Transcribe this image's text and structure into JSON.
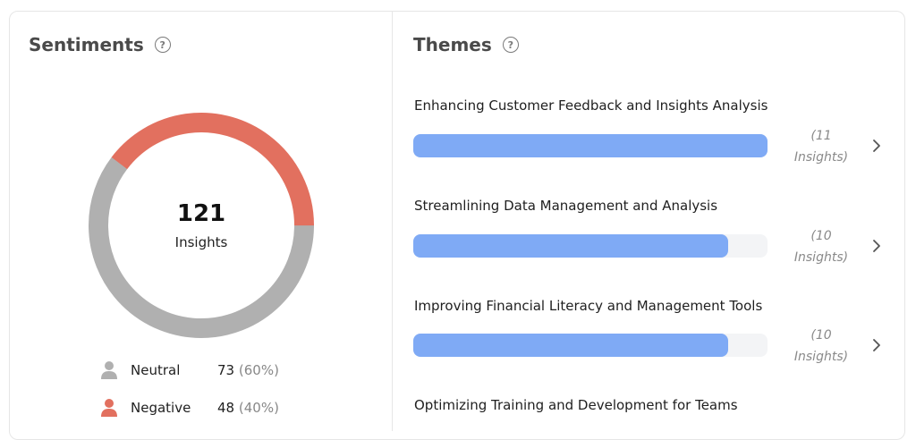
{
  "sentiments": {
    "title": "Sentiments",
    "total": "121",
    "total_label": "Insights",
    "legend": [
      {
        "name": "Neutral",
        "count": "73",
        "percent": "(60%)",
        "value": 73,
        "color": "#b0b0b0"
      },
      {
        "name": "Negative",
        "count": "48",
        "percent": "(40%)",
        "value": 48,
        "color": "#e2705f"
      }
    ]
  },
  "themes": {
    "title": "Themes",
    "items": [
      {
        "title": "Enhancing Customer Feedback and Insights Analysis",
        "count_line1": "(11",
        "count_line2": "Insights)",
        "fraction": 1.0
      },
      {
        "title": "Streamlining Data Management and Analysis",
        "count_line1": "(10",
        "count_line2": "Insights)",
        "fraction": 0.89
      },
      {
        "title": "Improving Financial Literacy and Management Tools",
        "count_line1": "(10",
        "count_line2": "Insights)",
        "fraction": 0.89
      },
      {
        "title": "Optimizing Training and Development for Teams"
      }
    ]
  },
  "colors": {
    "bar": "#7faaf5",
    "neutral": "#b0b0b0",
    "negative": "#e2705f"
  }
}
